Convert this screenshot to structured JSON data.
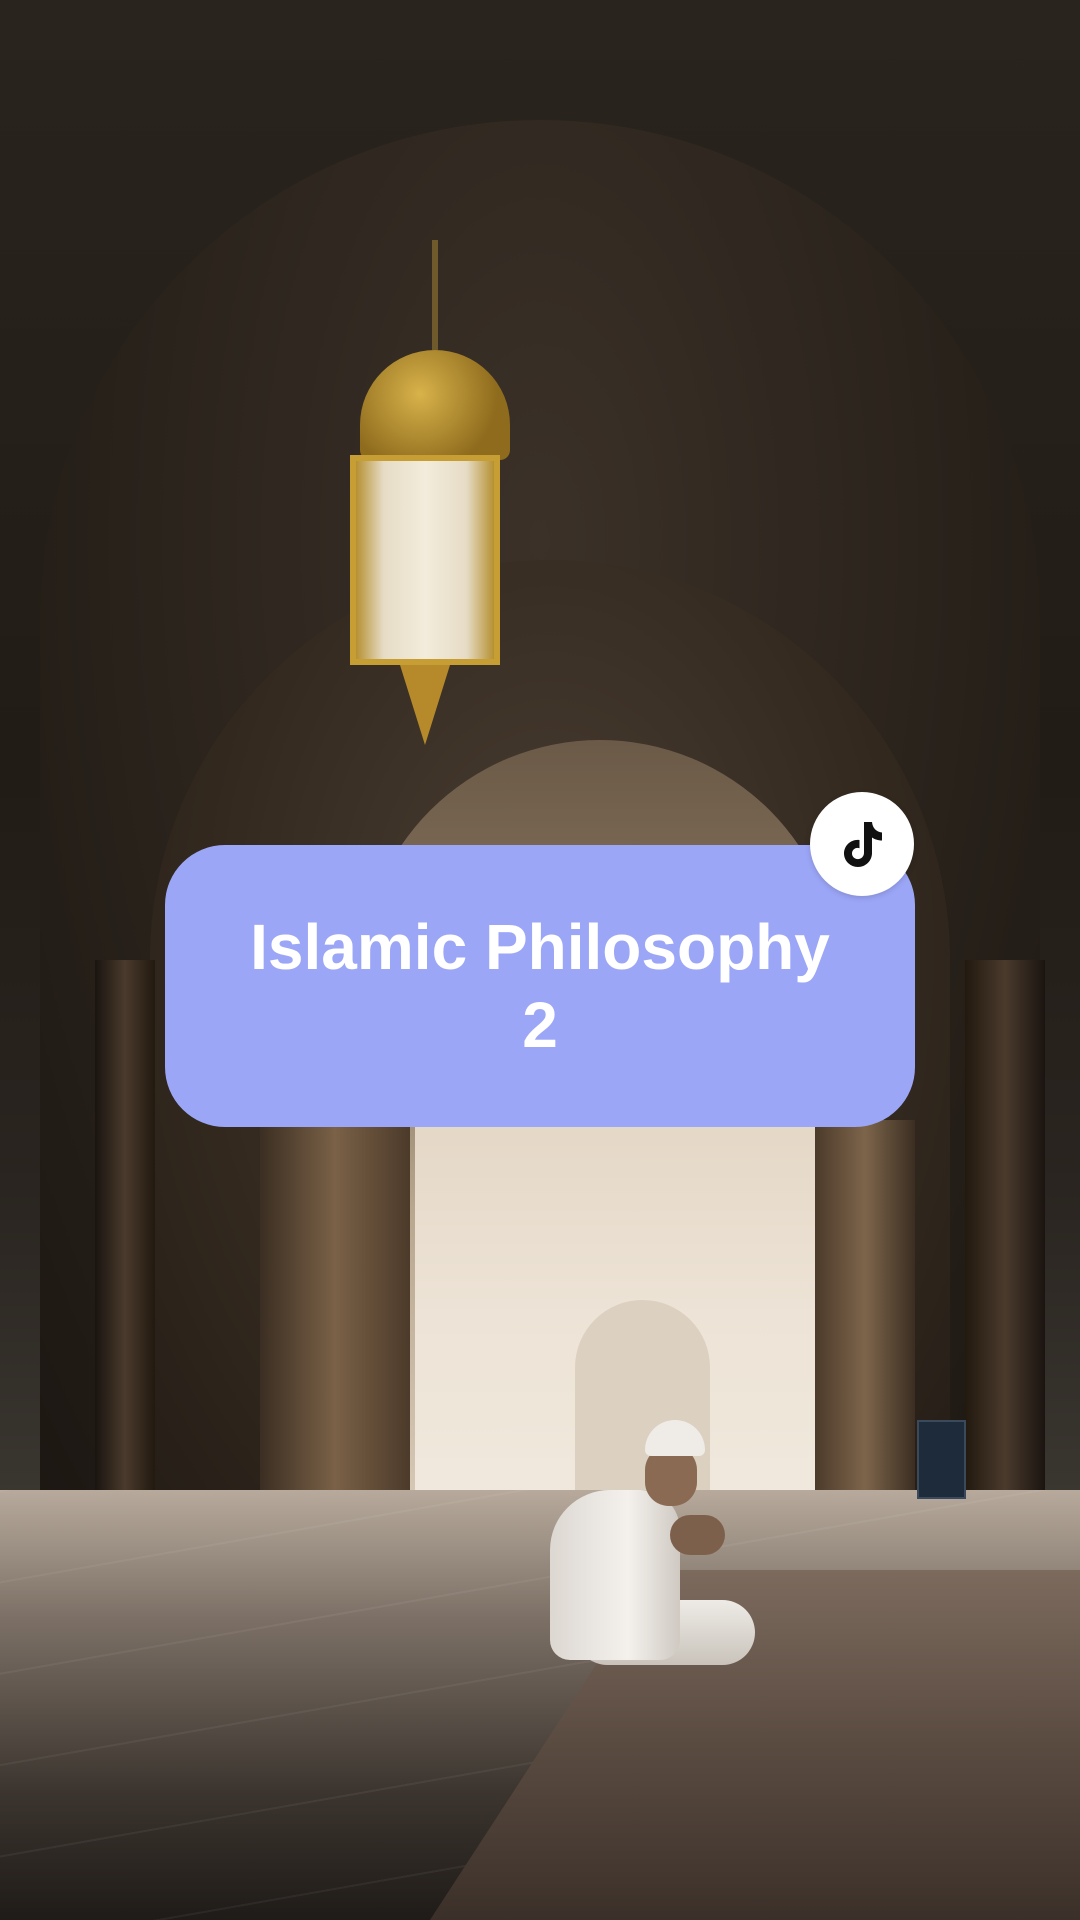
{
  "overlay": {
    "title_line1": "Islamic Philosophy",
    "title_line2": "2",
    "card_color": "#9ca6f7",
    "text_color": "#ffffff"
  },
  "badge": {
    "icon": "tiktok-icon",
    "background": "#ffffff",
    "icon_color": "#111111"
  },
  "background": {
    "subject": "person praying in mosque hall"
  }
}
